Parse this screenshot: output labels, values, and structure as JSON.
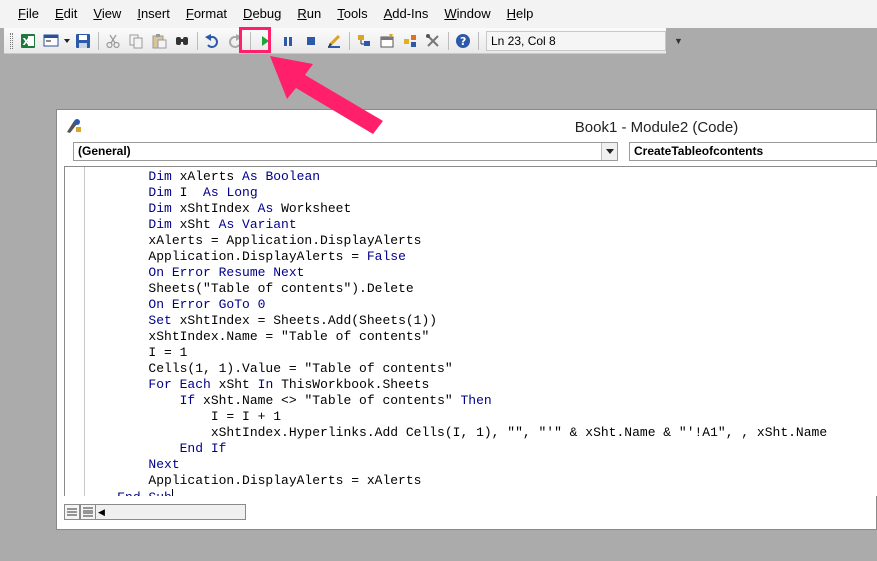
{
  "menu": {
    "items": [
      "File",
      "Edit",
      "View",
      "Insert",
      "Format",
      "Debug",
      "Run",
      "Tools",
      "Add-Ins",
      "Window",
      "Help"
    ]
  },
  "toolbar": {
    "icons": [
      "excel-icon",
      "insert-userform-icon",
      "save-icon",
      "cut-icon",
      "copy-icon",
      "paste-icon",
      "find-icon",
      "undo-icon",
      "redo-icon",
      "run-icon",
      "break-icon",
      "reset-icon",
      "design-mode-icon",
      "project-explorer-icon",
      "properties-icon",
      "object-browser-icon",
      "toolbox-icon",
      "help-icon"
    ],
    "cursor_position": "Ln 23, Col 8"
  },
  "colors": {
    "highlight": "#ff1f6a",
    "keyword": "#00008b",
    "background": "#ababab"
  },
  "code_window": {
    "title": "Book1 - Module2 (Code)",
    "object_dropdown": "(General)",
    "procedure_dropdown": "CreateTableofcontents",
    "lines": [
      [
        {
          "t": "        "
        },
        {
          "t": "Dim",
          "k": 1
        },
        {
          "t": " xAlerts "
        },
        {
          "t": "As Boolean",
          "k": 1
        }
      ],
      [
        {
          "t": "        "
        },
        {
          "t": "Dim",
          "k": 1
        },
        {
          "t": " I  "
        },
        {
          "t": "As Long",
          "k": 1
        }
      ],
      [
        {
          "t": "        "
        },
        {
          "t": "Dim",
          "k": 1
        },
        {
          "t": " xShtIndex "
        },
        {
          "t": "As",
          "k": 1
        },
        {
          "t": " Worksheet"
        }
      ],
      [
        {
          "t": "        "
        },
        {
          "t": "Dim",
          "k": 1
        },
        {
          "t": " xSht "
        },
        {
          "t": "As Variant",
          "k": 1
        }
      ],
      [
        {
          "t": "        xAlerts = Application.DisplayAlerts"
        }
      ],
      [
        {
          "t": "        Application.DisplayAlerts = "
        },
        {
          "t": "False",
          "k": 1
        }
      ],
      [
        {
          "t": "        "
        },
        {
          "t": "On Error Resume Next",
          "k": 1
        }
      ],
      [
        {
          "t": "        Sheets(\"Table of contents\").Delete"
        }
      ],
      [
        {
          "t": "        "
        },
        {
          "t": "On Error GoTo 0",
          "k": 1
        }
      ],
      [
        {
          "t": "        "
        },
        {
          "t": "Set",
          "k": 1
        },
        {
          "t": " xShtIndex = Sheets.Add(Sheets(1))"
        }
      ],
      [
        {
          "t": "        xShtIndex.Name = \"Table of contents\""
        }
      ],
      [
        {
          "t": "        I = 1"
        }
      ],
      [
        {
          "t": "        Cells(1, 1).Value = \"Table of contents\""
        }
      ],
      [
        {
          "t": "        "
        },
        {
          "t": "For Each",
          "k": 1
        },
        {
          "t": " xSht "
        },
        {
          "t": "In",
          "k": 1
        },
        {
          "t": " ThisWorkbook.Sheets"
        }
      ],
      [
        {
          "t": "            "
        },
        {
          "t": "If",
          "k": 1
        },
        {
          "t": " xSht.Name <> \"Table of contents\" "
        },
        {
          "t": "Then",
          "k": 1
        }
      ],
      [
        {
          "t": "                I = I + 1"
        }
      ],
      [
        {
          "t": "                xShtIndex.Hyperlinks.Add Cells(I, 1), \"\", \"'\" & xSht.Name & \"'!A1\", , xSht.Name"
        }
      ],
      [
        {
          "t": "            "
        },
        {
          "t": "End If",
          "k": 1
        }
      ],
      [
        {
          "t": "        "
        },
        {
          "t": "Next",
          "k": 1
        }
      ],
      [
        {
          "t": "        Application.DisplayAlerts = xAlerts"
        }
      ],
      [
        {
          "t": "    "
        },
        {
          "t": "End Sub",
          "k": 1
        }
      ]
    ]
  }
}
